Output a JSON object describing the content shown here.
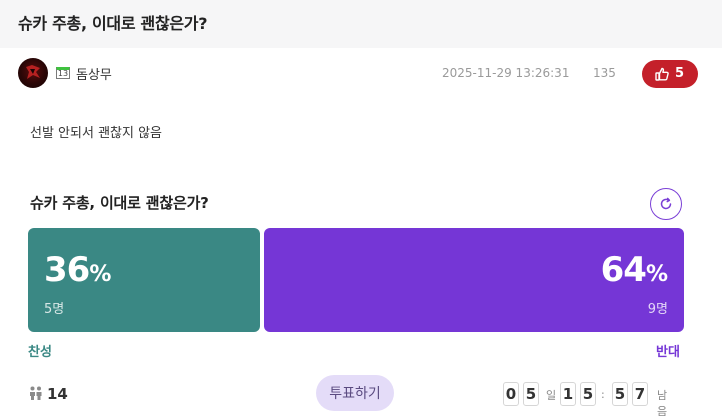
{
  "post": {
    "title": "슈카 주총, 이대로 괜찮은가?",
    "author": "돔상무",
    "level": "13",
    "datetime": "2025-11-29 13:26:31",
    "views": "135",
    "likes": "5",
    "body": "선발 안되서 괜찮지 않음"
  },
  "poll": {
    "title": "슈카 주총, 이대로 괜찮은가?",
    "agree": {
      "percent": "36",
      "unit": "%",
      "count": "5명",
      "label": "찬성",
      "color": "#3a8884"
    },
    "oppose": {
      "percent": "64",
      "unit": "%",
      "count": "9명",
      "label": "반대",
      "color": "#7536d6"
    },
    "voters": "14",
    "vote_button": "투표하기",
    "countdown": {
      "d1": "0",
      "d2": "5",
      "day_label": "일",
      "h1": "1",
      "h2": "5",
      "sep": ":",
      "m1": "5",
      "m2": "7",
      "remaining_label": "남음"
    }
  },
  "icons": {
    "avatar": "avatar-image",
    "like": "thumbs-up-icon",
    "refresh": "refresh-icon",
    "voters": "people-icon"
  },
  "colors": {
    "like": "#c4202a",
    "agree": "#3a8884",
    "oppose": "#7536d6",
    "vote_button_bg": "#e4dcf8"
  }
}
